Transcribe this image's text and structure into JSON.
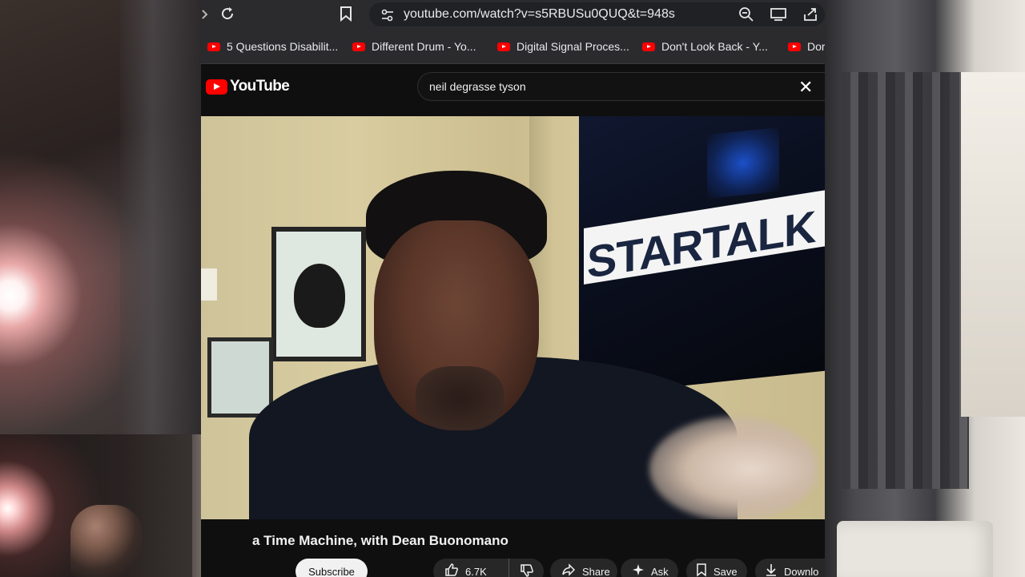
{
  "browser": {
    "url": "youtube.com/watch?v=s5RBUSu0QUQ&t=948s",
    "icons": {
      "forward": "chevron-right-icon",
      "reload": "reload-icon",
      "bookmark": "bookmark-icon",
      "site_info": "tune-icon",
      "zoom": "zoom-icon",
      "cast": "cast-icon",
      "share": "share-icon"
    }
  },
  "bookmarks": [
    {
      "label": "5 Questions Disabilit..."
    },
    {
      "label": "Different Drum - Yo..."
    },
    {
      "label": "Digital Signal Proces..."
    },
    {
      "label": "Don't Look Back - Y..."
    },
    {
      "label": "Dor"
    }
  ],
  "youtube": {
    "logo_text": "YouTube",
    "search_value": "neil degrasse tyson",
    "video": {
      "tv_logo_text": "STARTALK",
      "title": "a Time Machine, with Dean Buonomano"
    },
    "actions": {
      "subscribe": "Subscribe",
      "likes": "6.7K",
      "share": "Share",
      "ask": "Ask",
      "save": "Save",
      "download": "Downlo"
    }
  },
  "colors": {
    "brand_red": "#ff0000",
    "page_bg": "#0f0f0f",
    "toolbar": "#2b2b2e"
  }
}
